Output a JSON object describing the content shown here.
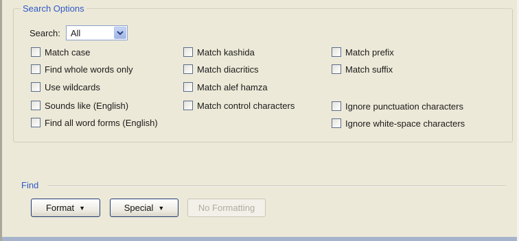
{
  "search_options": {
    "legend": "Search Options",
    "search_label": "Search:",
    "search_value": "All",
    "options_col1": [
      {
        "label": "Match case",
        "checked": false
      },
      {
        "label": "Find whole words only",
        "checked": false
      },
      {
        "label": "Use wildcards",
        "checked": false
      },
      {
        "label": "Sounds like (English)",
        "checked": false
      },
      {
        "label": "Find all word forms (English)",
        "checked": false
      }
    ],
    "options_col2": [
      {
        "label": "Match kashida",
        "checked": false
      },
      {
        "label": "Match diacritics",
        "checked": false
      },
      {
        "label": "Match alef hamza",
        "checked": false
      },
      {
        "label": "Match control characters",
        "checked": false
      }
    ],
    "options_col3": [
      {
        "label": "Match prefix",
        "checked": false
      },
      {
        "label": "Match suffix",
        "checked": false
      },
      {
        "label": "Ignore punctuation characters",
        "checked": false
      },
      {
        "label": "Ignore white-space characters",
        "checked": false
      }
    ]
  },
  "find": {
    "legend": "Find",
    "format_label": "Format",
    "special_label": "Special",
    "no_formatting_label": "No Formatting"
  },
  "colors": {
    "legend": "#2f58c8",
    "dialog_bg": "#ece9d8",
    "button_border": "#1f3a73"
  }
}
